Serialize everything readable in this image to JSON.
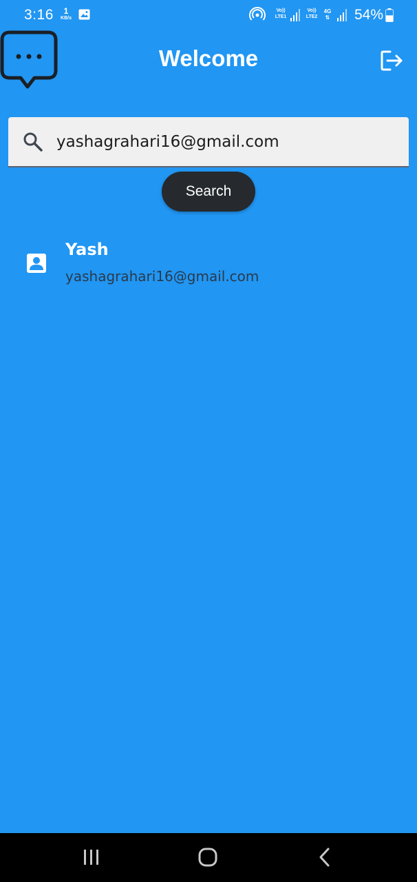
{
  "status_bar": {
    "time": "3:16",
    "net_speed_value": "1",
    "net_speed_unit": "KB/s",
    "sim1_label_top": "Vo))",
    "sim1_label_bottom": "LTE1",
    "sim2_label_top": "Vo))",
    "sim2_label_bottom": "LTE2",
    "network_type": "4G",
    "battery_percent": "54%",
    "battery_level": 0.54,
    "icons": [
      "gallery-icon",
      "hotspot-icon",
      "signal-icon",
      "battery-icon"
    ]
  },
  "header": {
    "title": "Welcome",
    "logo_icon": "chat-bubble-icon",
    "logout_icon": "logout-icon"
  },
  "search": {
    "value": "yashagrahari16@gmail.com",
    "icon": "search-icon",
    "button_label": "Search"
  },
  "results": [
    {
      "name": "Yash",
      "email": "yashagrahari16@gmail.com",
      "icon": "contact-icon"
    }
  ],
  "nav_bar": {
    "items": [
      "recent-apps-icon",
      "home-icon",
      "back-icon"
    ]
  },
  "colors": {
    "background": "#2196F3",
    "search_field": "#f0f0f0",
    "button": "#262a2e",
    "nav_bar": "#000000"
  }
}
